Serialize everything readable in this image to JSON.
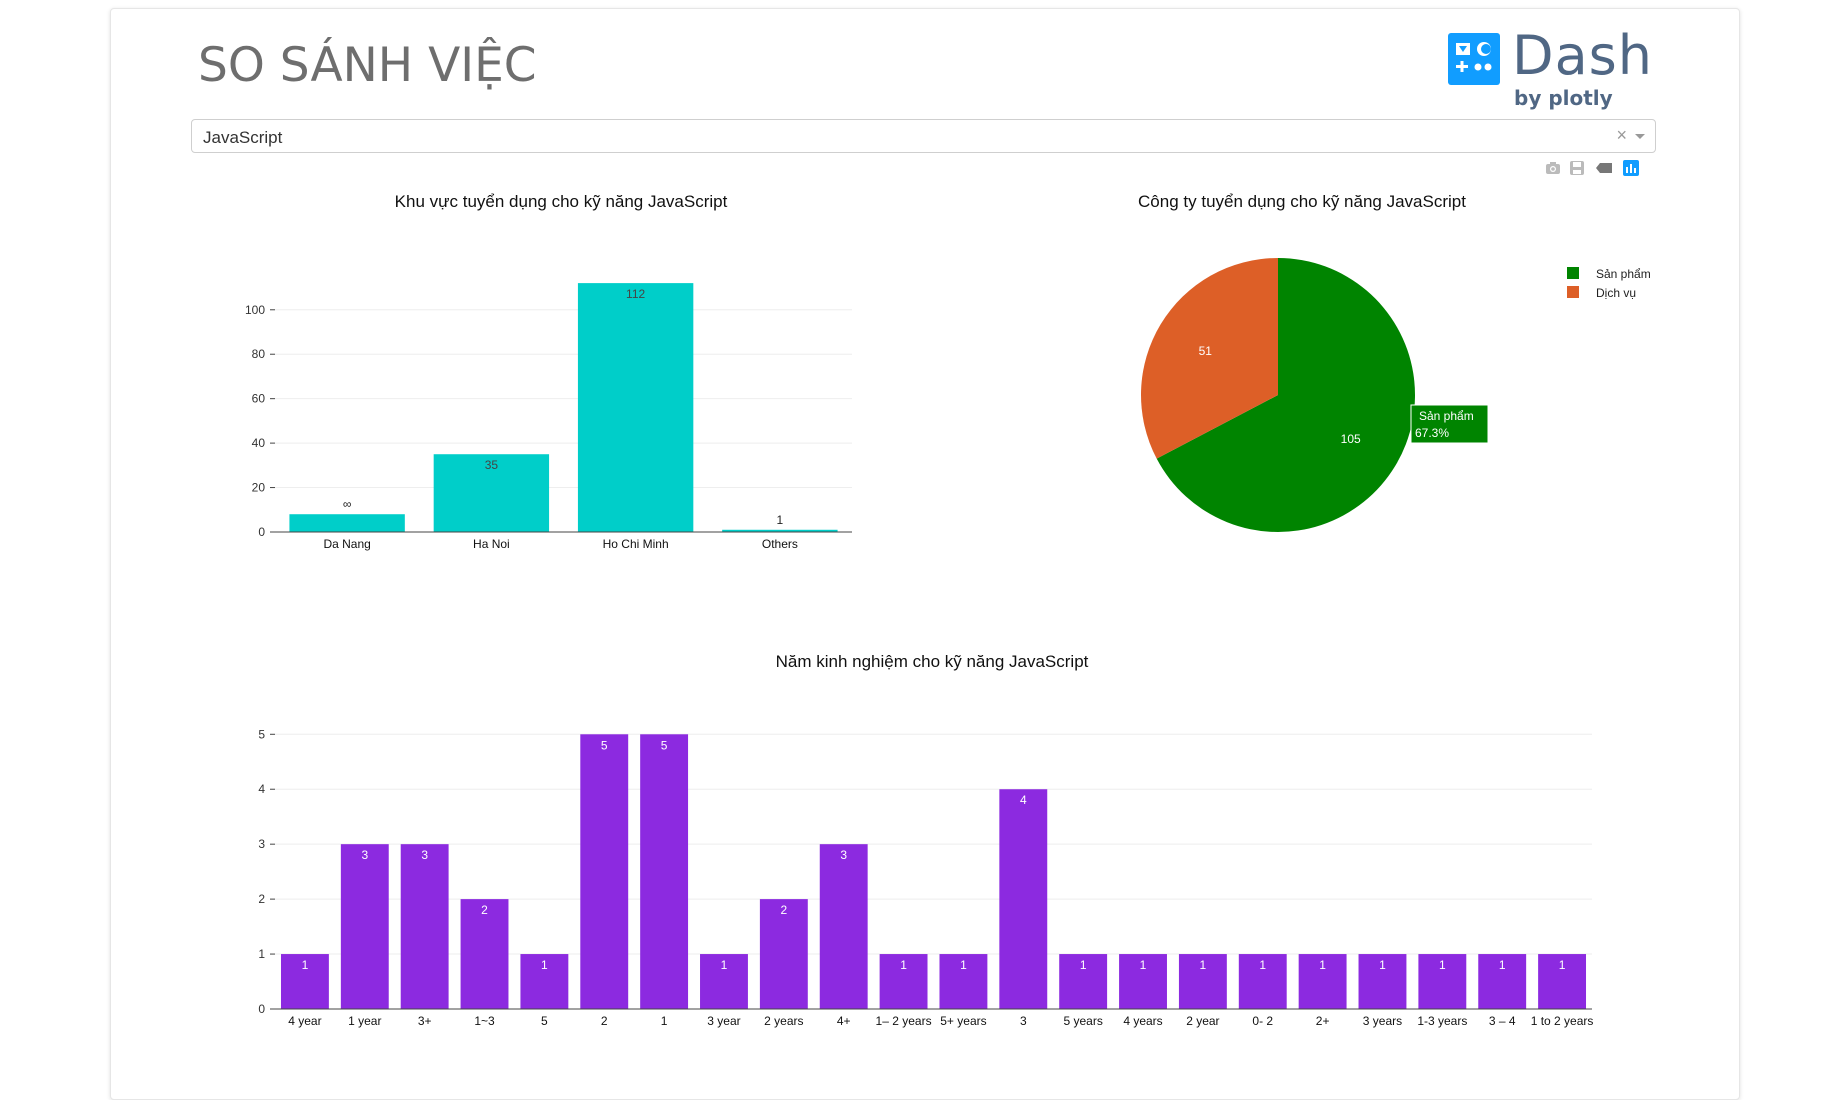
{
  "header": {
    "title": "SO SÁNH VIỆC",
    "logo_main": "Dash",
    "logo_sub": "by plotly"
  },
  "dropdown": {
    "value": "JavaScript",
    "clear_glyph": "×"
  },
  "modebar": {
    "icons": [
      "camera-icon",
      "save-icon",
      "tag-icon",
      "plotly-logo-icon"
    ]
  },
  "colors": {
    "bar1": "#00cec9",
    "pie_san_pham": "#008400",
    "pie_dich_vu": "#dd5f27",
    "bar3": "#8c2ae0"
  },
  "chart_data": [
    {
      "type": "bar",
      "title": "Khu vực tuyển dụng cho kỹ năng JavaScript",
      "categories": [
        "Da Nang",
        "Ha Noi",
        "Ho Chi Minh",
        "Others"
      ],
      "values": [
        8,
        35,
        112,
        1
      ],
      "value_labels": [
        "∞",
        "35",
        "112",
        "1"
      ],
      "yticks": [
        0,
        20,
        40,
        60,
        80,
        100
      ],
      "ylim": [
        0,
        117.9
      ],
      "grid": true
    },
    {
      "type": "pie",
      "title": "Công ty tuyển dụng cho kỹ năng JavaScript",
      "labels": [
        "Sản phẩm",
        "Dịch vụ"
      ],
      "values": [
        105,
        51
      ],
      "legend_position": "top-right",
      "hover": {
        "label": "Sản phẩm",
        "percent": "67.3%"
      }
    },
    {
      "type": "bar",
      "title": "Năm kinh nghiệm cho kỹ năng JavaScript",
      "categories": [
        "4 year",
        "1 year",
        "3+",
        "1~3",
        "5",
        "2",
        "1",
        "3 year",
        "2 years",
        "4+",
        "1– 2 years",
        "5+ years",
        "3",
        "5 years",
        "4 years",
        "2 year",
        "0- 2",
        "2+",
        "3 years",
        "1-3 years",
        "3 – 4",
        "1 to 2 years"
      ],
      "values": [
        1,
        3,
        3,
        2,
        1,
        5,
        5,
        1,
        2,
        3,
        1,
        1,
        4,
        1,
        1,
        1,
        1,
        1,
        1,
        1,
        1,
        1
      ],
      "yticks": [
        0,
        1,
        2,
        3,
        4,
        5
      ],
      "ylim": [
        0,
        5.26
      ],
      "grid": true
    }
  ]
}
